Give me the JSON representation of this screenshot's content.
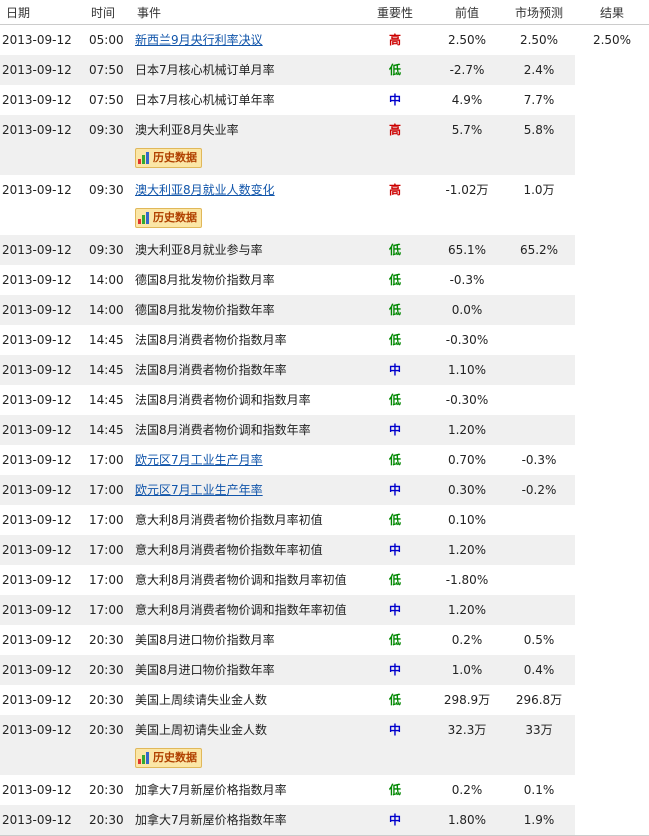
{
  "headers": {
    "date": "日期",
    "time": "时间",
    "event": "事件",
    "importance": "重要性",
    "previous": "前值",
    "forecast": "市场预测",
    "result": "结果"
  },
  "history_label": "历史数据",
  "rows": [
    {
      "date": "2013-09-12",
      "time": "05:00",
      "event": "新西兰9月央行利率决议",
      "link": true,
      "imp": "高",
      "lvl": "high",
      "prev": "2.50%",
      "fc": "2.50%",
      "res": "2.50%",
      "hist": false
    },
    {
      "date": "2013-09-12",
      "time": "07:50",
      "event": "日本7月核心机械订单月率",
      "link": false,
      "imp": "低",
      "lvl": "low",
      "prev": "-2.7%",
      "fc": "2.4%",
      "res": "",
      "hist": false
    },
    {
      "date": "2013-09-12",
      "time": "07:50",
      "event": "日本7月核心机械订单年率",
      "link": false,
      "imp": "中",
      "lvl": "mid",
      "prev": "4.9%",
      "fc": "7.7%",
      "res": "",
      "hist": false
    },
    {
      "date": "2013-09-12",
      "time": "09:30",
      "event": "澳大利亚8月失业率",
      "link": false,
      "imp": "高",
      "lvl": "high",
      "prev": "5.7%",
      "fc": "5.8%",
      "res": "",
      "hist": true
    },
    {
      "date": "2013-09-12",
      "time": "09:30",
      "event": "澳大利亚8月就业人数变化",
      "link": true,
      "imp": "高",
      "lvl": "high",
      "prev": "-1.02万",
      "fc": "1.0万",
      "res": "",
      "hist": true
    },
    {
      "date": "2013-09-12",
      "time": "09:30",
      "event": "澳大利亚8月就业参与率",
      "link": false,
      "imp": "低",
      "lvl": "low",
      "prev": "65.1%",
      "fc": "65.2%",
      "res": "",
      "hist": false
    },
    {
      "date": "2013-09-12",
      "time": "14:00",
      "event": "德国8月批发物价指数月率",
      "link": false,
      "imp": "低",
      "lvl": "low",
      "prev": "-0.3%",
      "fc": "",
      "res": "",
      "hist": false
    },
    {
      "date": "2013-09-12",
      "time": "14:00",
      "event": "德国8月批发物价指数年率",
      "link": false,
      "imp": "低",
      "lvl": "low",
      "prev": "0.0%",
      "fc": "",
      "res": "",
      "hist": false
    },
    {
      "date": "2013-09-12",
      "time": "14:45",
      "event": "法国8月消费者物价指数月率",
      "link": false,
      "imp": "低",
      "lvl": "low",
      "prev": "-0.30%",
      "fc": "",
      "res": "",
      "hist": false
    },
    {
      "date": "2013-09-12",
      "time": "14:45",
      "event": "法国8月消费者物价指数年率",
      "link": false,
      "imp": "中",
      "lvl": "mid",
      "prev": "1.10%",
      "fc": "",
      "res": "",
      "hist": false
    },
    {
      "date": "2013-09-12",
      "time": "14:45",
      "event": "法国8月消费者物价调和指数月率",
      "link": false,
      "imp": "低",
      "lvl": "low",
      "prev": "-0.30%",
      "fc": "",
      "res": "",
      "hist": false
    },
    {
      "date": "2013-09-12",
      "time": "14:45",
      "event": "法国8月消费者物价调和指数年率",
      "link": false,
      "imp": "中",
      "lvl": "mid",
      "prev": "1.20%",
      "fc": "",
      "res": "",
      "hist": false
    },
    {
      "date": "2013-09-12",
      "time": "17:00",
      "event": "欧元区7月工业生产月率",
      "link": true,
      "imp": "低",
      "lvl": "low",
      "prev": "0.70%",
      "fc": "-0.3%",
      "res": "",
      "hist": false
    },
    {
      "date": "2013-09-12",
      "time": "17:00",
      "event": "欧元区7月工业生产年率",
      "link": true,
      "imp": "中",
      "lvl": "mid",
      "prev": "0.30%",
      "fc": "-0.2%",
      "res": "",
      "hist": false
    },
    {
      "date": "2013-09-12",
      "time": "17:00",
      "event": "意大利8月消费者物价指数月率初值",
      "link": false,
      "imp": "低",
      "lvl": "low",
      "prev": "0.10%",
      "fc": "",
      "res": "",
      "hist": false
    },
    {
      "date": "2013-09-12",
      "time": "17:00",
      "event": "意大利8月消费者物价指数年率初值",
      "link": false,
      "imp": "中",
      "lvl": "mid",
      "prev": "1.20%",
      "fc": "",
      "res": "",
      "hist": false
    },
    {
      "date": "2013-09-12",
      "time": "17:00",
      "event": "意大利8月消费者物价调和指数月率初值",
      "link": false,
      "imp": "低",
      "lvl": "low",
      "prev": "-1.80%",
      "fc": "",
      "res": "",
      "hist": false
    },
    {
      "date": "2013-09-12",
      "time": "17:00",
      "event": "意大利8月消费者物价调和指数年率初值",
      "link": false,
      "imp": "中",
      "lvl": "mid",
      "prev": "1.20%",
      "fc": "",
      "res": "",
      "hist": false
    },
    {
      "date": "2013-09-12",
      "time": "20:30",
      "event": "美国8月进口物价指数月率",
      "link": false,
      "imp": "低",
      "lvl": "low",
      "prev": "0.2%",
      "fc": "0.5%",
      "res": "",
      "hist": false
    },
    {
      "date": "2013-09-12",
      "time": "20:30",
      "event": "美国8月进口物价指数年率",
      "link": false,
      "imp": "中",
      "lvl": "mid",
      "prev": "1.0%",
      "fc": "0.4%",
      "res": "",
      "hist": false
    },
    {
      "date": "2013-09-12",
      "time": "20:30",
      "event": "美国上周续请失业金人数",
      "link": false,
      "imp": "低",
      "lvl": "low",
      "prev": "298.9万",
      "fc": "296.8万",
      "res": "",
      "hist": false
    },
    {
      "date": "2013-09-12",
      "time": "20:30",
      "event": "美国上周初请失业金人数",
      "link": false,
      "imp": "中",
      "lvl": "mid",
      "prev": "32.3万",
      "fc": "33万",
      "res": "",
      "hist": true
    },
    {
      "date": "2013-09-12",
      "time": "20:30",
      "event": "加拿大7月新屋价格指数月率",
      "link": false,
      "imp": "低",
      "lvl": "low",
      "prev": "0.2%",
      "fc": "0.1%",
      "res": "",
      "hist": false
    },
    {
      "date": "2013-09-12",
      "time": "20:30",
      "event": "加拿大7月新屋价格指数年率",
      "link": false,
      "imp": "中",
      "lvl": "mid",
      "prev": "1.80%",
      "fc": "1.9%",
      "res": "",
      "hist": false
    }
  ]
}
